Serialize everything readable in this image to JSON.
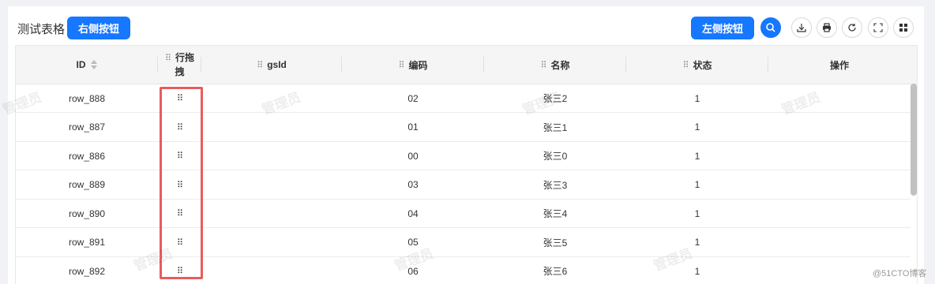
{
  "toolbar": {
    "title": "测试表格",
    "right_button": "右侧按钮",
    "left_button": "左侧按钮",
    "icons": [
      "search-icon",
      "download-icon",
      "print-icon",
      "refresh-icon",
      "fullscreen-icon",
      "columns-icon"
    ]
  },
  "table": {
    "columns": [
      {
        "key": "id",
        "label": "ID",
        "sortable": true
      },
      {
        "key": "drag",
        "label": "行拖拽",
        "draggable": true
      },
      {
        "key": "gsId",
        "label": "gsId",
        "draggable": true
      },
      {
        "key": "code",
        "label": "编码",
        "draggable": true
      },
      {
        "key": "name",
        "label": "名称",
        "draggable": true
      },
      {
        "key": "status",
        "label": "状态",
        "draggable": true
      },
      {
        "key": "action",
        "label": "操作"
      }
    ],
    "rows": [
      {
        "id": "row_888",
        "code": "02",
        "name": "张三2",
        "status": "1"
      },
      {
        "id": "row_887",
        "code": "01",
        "name": "张三1",
        "status": "1"
      },
      {
        "id": "row_886",
        "code": "00",
        "name": "张三0",
        "status": "1"
      },
      {
        "id": "row_889",
        "code": "03",
        "name": "张三3",
        "status": "1"
      },
      {
        "id": "row_890",
        "code": "04",
        "name": "张三4",
        "status": "1"
      },
      {
        "id": "row_891",
        "code": "05",
        "name": "张三5",
        "status": "1"
      },
      {
        "id": "row_892",
        "code": "06",
        "name": "张三6",
        "status": "1"
      }
    ]
  },
  "watermark": "管理员",
  "corner_watermark": "@51CTO博客",
  "colors": {
    "primary": "#1677ff",
    "highlight": "#e85c5c"
  }
}
